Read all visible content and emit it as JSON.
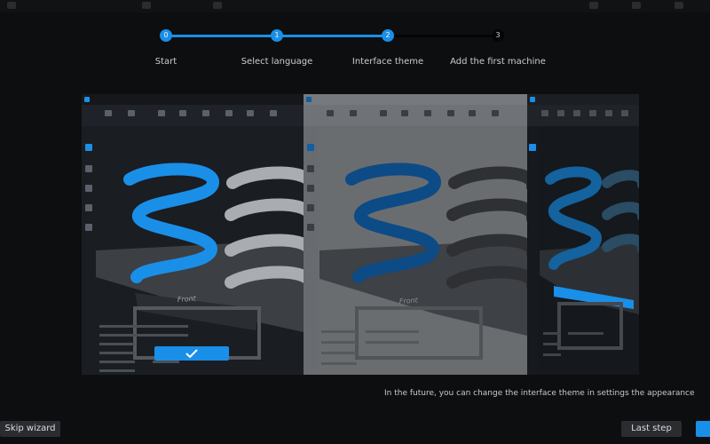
{
  "wizard": {
    "steps": [
      {
        "number": "0",
        "label": "Start",
        "state": "done"
      },
      {
        "number": "1",
        "label": "Select language",
        "state": "done"
      },
      {
        "number": "2",
        "label": "Interface theme",
        "state": "current"
      },
      {
        "number": "3",
        "label": "Add the first machine",
        "state": "pending"
      }
    ],
    "note": "In the future, you can change the interface theme in settings the appearance",
    "skip_label": "Skip wizard",
    "last_label": "Last step"
  },
  "theme_preview": {
    "options": [
      "dark",
      "light",
      "deep-dark"
    ],
    "selected": "dark",
    "plate_text": "Front",
    "confirm_icon": "check-icon"
  },
  "colors": {
    "accent": "#1a8fe8",
    "background": "#0d0e10",
    "button": "#2a2c30"
  }
}
